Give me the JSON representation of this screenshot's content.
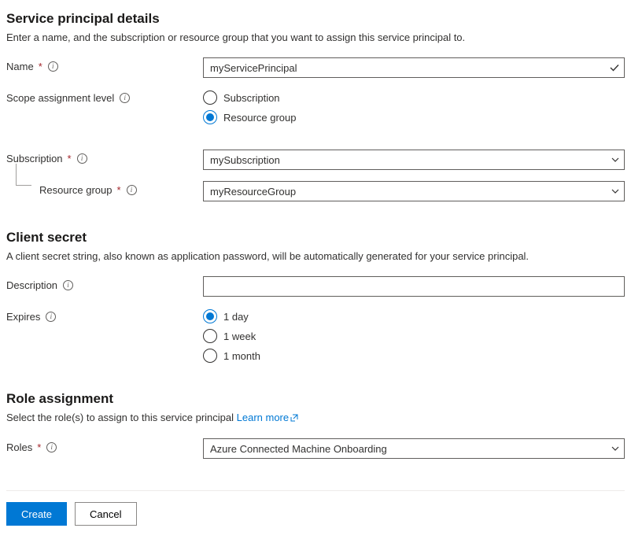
{
  "sections": {
    "principal": {
      "heading": "Service principal details",
      "desc": "Enter a name, and the subscription or resource group that you want to assign this service principal to."
    },
    "secret": {
      "heading": "Client secret",
      "desc": "A client secret string, also known as application password, will be automatically generated for your service principal."
    },
    "role": {
      "heading": "Role assignment",
      "desc_prefix": "Select the role(s) to assign to this service principal ",
      "learn_more": "Learn more"
    }
  },
  "labels": {
    "name": "Name",
    "scope": "Scope assignment level",
    "subscription": "Subscription",
    "resource_group": "Resource group",
    "description": "Description",
    "expires": "Expires",
    "roles": "Roles"
  },
  "values": {
    "name": "myServicePrincipal",
    "subscription": "mySubscription",
    "resource_group": "myResourceGroup",
    "description": "",
    "roles": "Azure Connected Machine Onboarding"
  },
  "scope_options": {
    "subscription": "Subscription",
    "resource_group": "Resource group",
    "selected": "resource_group"
  },
  "expires_options": {
    "day": "1 day",
    "week": "1 week",
    "month": "1 month",
    "selected": "day"
  },
  "buttons": {
    "create": "Create",
    "cancel": "Cancel"
  }
}
